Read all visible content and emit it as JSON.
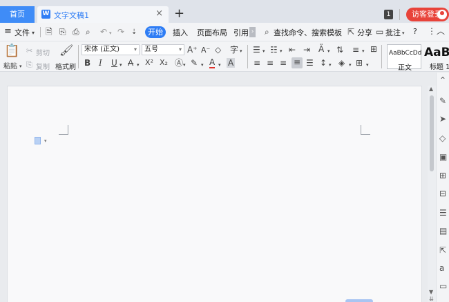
{
  "titlebar": {
    "home_tab": "首页",
    "doc_tab": "文字文稿1",
    "doc_tab_logo": "W",
    "close": "×",
    "new_tab": "+",
    "badge_count": "1",
    "login": "访客登录"
  },
  "menubar": {
    "file": "文件",
    "items": [
      "开始",
      "插入",
      "页面布局",
      "引用"
    ],
    "active": "开始",
    "search": "查找命令、搜索模板",
    "share": "分享",
    "comment": "批注",
    "help": "?"
  },
  "ribbon": {
    "paste": "粘贴",
    "cut": "剪切",
    "copy": "复制",
    "format_painter": "格式刷",
    "font_name": "宋体 (正文)",
    "font_size": "五号",
    "bold": "B",
    "italic": "I",
    "underline": "U",
    "strike": "A",
    "superscript": "X²",
    "subscript": "X₂",
    "styles": [
      {
        "sample": "AaBbCcDd",
        "caption": "正文"
      },
      {
        "sample": "AaB",
        "caption": "标题 1"
      }
    ]
  },
  "colors": {
    "accent": "#2e7df5",
    "home_tab": "#3f8cf7",
    "login_btn": "#e8433a",
    "page": "#f9f9fa",
    "background": "#e9ebee"
  }
}
